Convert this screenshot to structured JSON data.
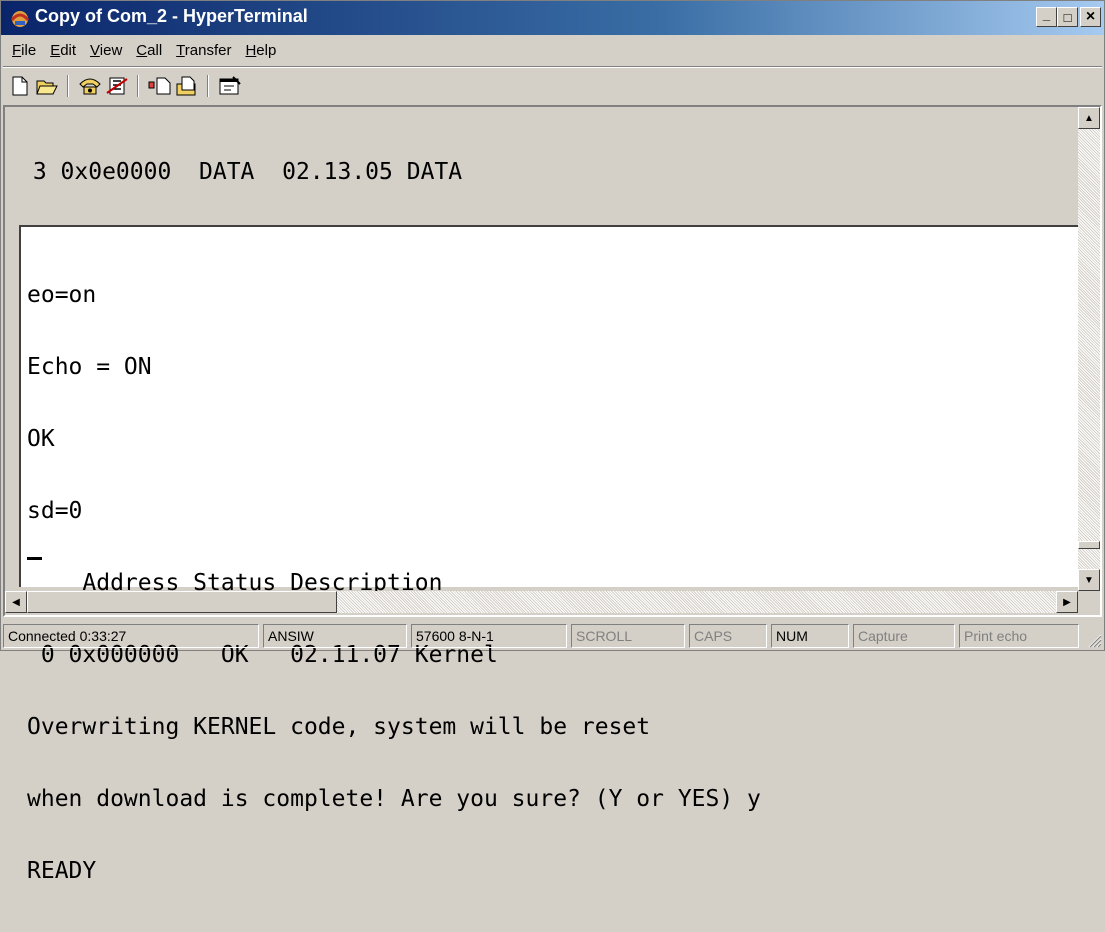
{
  "window": {
    "title": "Copy of Com_2 - HyperTerminal",
    "controls": {
      "minimize": "_",
      "maximize": "□",
      "close": "×"
    }
  },
  "menu": [
    {
      "key": "F",
      "rest": "ile"
    },
    {
      "key": "E",
      "rest": "dit"
    },
    {
      "key": "V",
      "rest": "iew"
    },
    {
      "key": "C",
      "rest": "all"
    },
    {
      "key": "T",
      "rest": "ransfer"
    },
    {
      "key": "H",
      "rest": "elp"
    }
  ],
  "toolbar": {
    "icons": [
      "new-icon",
      "open-icon",
      "connect-icon",
      "disconnect-icon",
      "send-icon",
      "receive-icon",
      "properties-icon"
    ]
  },
  "terminal": {
    "backscroll_lines": [
      " 3 0x0e0000  DATA  02.13.05 DATA",
      "OK"
    ],
    "screen_lines": [
      "eo=on",
      "Echo = ON",
      "OK",
      "sd=0",
      "    Address Status Description",
      " 0 0x000000   OK   02.11.07 Kernel",
      "Overwriting KERNEL code, system will be reset",
      "when download is complete! Are you sure? (Y or YES) y",
      "READY"
    ]
  },
  "statusbar": {
    "connected": "Connected 0:33:27",
    "emulation": "ANSIW",
    "port_settings": "57600 8-N-1",
    "scroll": "SCROLL",
    "caps": "CAPS",
    "num": "NUM",
    "capture": "Capture",
    "print_echo": "Print echo"
  },
  "colors": {
    "title_start": "#0a246a",
    "title_end": "#a6caf0",
    "chrome": "#d4d0c8"
  }
}
